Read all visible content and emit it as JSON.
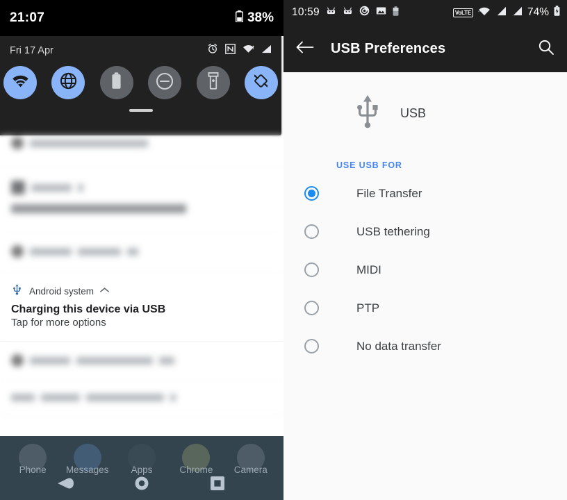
{
  "left_panel": {
    "status_bar": {
      "time": "21:07",
      "battery_percent": "38%",
      "battery_icon": "battery-low-icon"
    },
    "quick_settings": {
      "date": "Fri 17 Apr",
      "status_icons": [
        "alarm-icon",
        "nfc-icon",
        "wifi-icon",
        "signal-icon"
      ],
      "tiles": [
        {
          "name": "wifi-tile",
          "icon": "wifi-icon",
          "state": "on"
        },
        {
          "name": "mobile-data-tile",
          "icon": "globe-icon",
          "state": "on"
        },
        {
          "name": "battery-saver-tile",
          "icon": "battery-icon",
          "state": "off"
        },
        {
          "name": "do-not-disturb-tile",
          "icon": "minus-circle-icon",
          "state": "off"
        },
        {
          "name": "flashlight-tile",
          "icon": "flashlight-icon",
          "state": "off"
        },
        {
          "name": "auto-rotate-tile",
          "icon": "rotate-icon",
          "state": "on"
        }
      ]
    },
    "notifications": [
      {
        "id": "n0",
        "blurred": true,
        "app_name": "",
        "title": "",
        "body": "",
        "icon": "dot-icon"
      },
      {
        "id": "n1",
        "blurred": true,
        "app_name": "",
        "title": "",
        "body": "",
        "icon": "square-icon"
      },
      {
        "id": "n2",
        "blurred": true,
        "app_name": "",
        "title": "",
        "body": "",
        "icon": "dot-icon"
      },
      {
        "id": "n3",
        "blurred": false,
        "app_name": "Android system",
        "title": "Charging this device via USB",
        "body": "Tap for more options",
        "icon": "usb-icon",
        "expand_glyph": "⌃"
      },
      {
        "id": "n4",
        "blurred": true,
        "app_name": "",
        "title": "",
        "body": "",
        "icon": "dot-icon"
      },
      {
        "id": "n5",
        "blurred": true,
        "app_name": "",
        "title": "",
        "body": "",
        "icon": "dot-icon"
      }
    ],
    "dock": {
      "apps": [
        {
          "label": "Phone"
        },
        {
          "label": "Messages"
        },
        {
          "label": "Apps"
        },
        {
          "label": "Chrome"
        },
        {
          "label": "Camera"
        }
      ],
      "nav": [
        {
          "name": "back-button",
          "icon": "back-icon"
        },
        {
          "name": "home-button",
          "icon": "home-icon"
        },
        {
          "name": "recents-button",
          "icon": "recents-icon"
        }
      ]
    }
  },
  "right_panel": {
    "status_bar": {
      "time": "10:59",
      "notification_icons": [
        "adb-icon",
        "adb-icon",
        "screen-record-icon",
        "screenshot-icon",
        "battery-saver-icon"
      ],
      "volte_label": "VoLTE",
      "right_icons": [
        "wifi-icon",
        "signal-icon",
        "signal-icon"
      ],
      "battery_percent": "74%",
      "battery_icon": "battery-charging-icon"
    },
    "app_bar": {
      "back_label": "back-arrow",
      "title": "USB Preferences",
      "search_label": "search"
    },
    "hero": {
      "icon": "usb-icon",
      "label": "USB"
    },
    "section": {
      "header": "USE USB FOR",
      "options": [
        {
          "label": "File Transfer",
          "selected": true
        },
        {
          "label": "USB tethering",
          "selected": false
        },
        {
          "label": "MIDI",
          "selected": false
        },
        {
          "label": "PTP",
          "selected": false
        },
        {
          "label": "No data transfer",
          "selected": false
        }
      ]
    }
  },
  "colors": {
    "accent_blue": "#4285f4",
    "radio_blue": "#1a8cf0",
    "tile_on": "#8ab4f8",
    "tile_off": "#5f6368",
    "shade_bg": "#212121",
    "statusbar_black": "#000000",
    "appbar_bg": "#1f1f1f",
    "page_bg": "#fafafa",
    "dock_bg": "#34444f"
  }
}
